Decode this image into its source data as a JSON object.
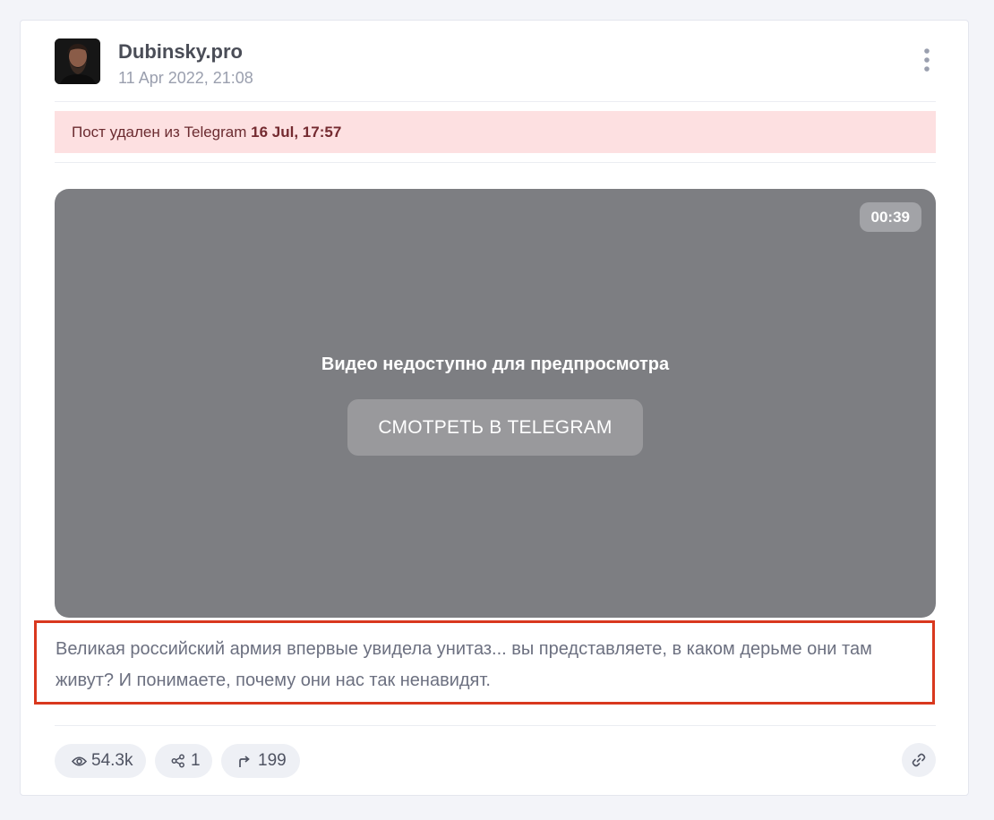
{
  "post": {
    "channel_name": "Dubinsky.pro",
    "date": "11 Apr 2022, 21:08",
    "deleted_notice_prefix": "Пост удален из Telegram",
    "deleted_at": "16 Jul, 17:57",
    "video": {
      "duration": "00:39",
      "unavailable_text": "Видео недоступно для предпросмотра",
      "watch_button_label": "СМОТРЕТЬ В TELEGRAM"
    },
    "text": "Великая российский армия впервые увидела унитаз... вы представляете, в каком дерьме они там живут? И понимаете, почему они нас так ненавидят."
  },
  "stats": {
    "views": "54.3k",
    "shares": "1",
    "forwards": "199"
  },
  "icons": {
    "views": "eye-icon",
    "shares": "share-icon",
    "forwards": "forward-arrow-icon",
    "menu": "vertical-dots-icon",
    "link": "link-icon"
  },
  "colors": {
    "background": "#f3f4f9",
    "deleted_banner": "#fde0e1",
    "video_placeholder": "#7d7e82",
    "highlight_border": "#d9381e"
  }
}
